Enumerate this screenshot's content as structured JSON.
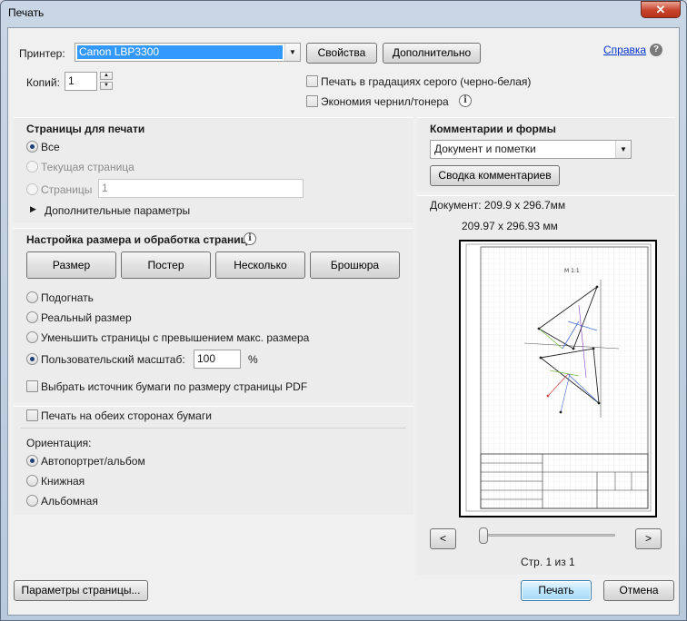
{
  "window": {
    "title": "Печать",
    "close_icon": "close-icon ✕"
  },
  "printer": {
    "label": "Принтер:",
    "selected": "Canon LBP3300",
    "properties_btn": "Свойства",
    "advanced_btn": "Дополнительно",
    "help_link": "Справка"
  },
  "copies": {
    "label": "Копий:",
    "value": "1"
  },
  "options": {
    "grayscale": "Печать в градациях серого (черно-белая)",
    "save_ink": "Экономия чернил/тонера"
  },
  "pages": {
    "heading": "Страницы для печати",
    "all": "Все",
    "current": "Текущая страница",
    "range": "Страницы",
    "range_value": "1",
    "more": "Дополнительные параметры"
  },
  "sizing": {
    "heading": "Настройка размера и обработка страниц",
    "tabs": [
      "Размер",
      "Постер",
      "Несколько",
      "Брошюра"
    ],
    "fit": "Подогнать",
    "actual": "Реальный размер",
    "shrink": "Уменьшить страницы с превышением макс. размера",
    "custom": "Пользовательский масштаб:",
    "custom_value": "100",
    "percent": "%",
    "source": "Выбрать источник бумаги по размеру страницы PDF"
  },
  "duplex": {
    "label": "Печать на обеих сторонах бумаги"
  },
  "orientation": {
    "heading": "Ориентация:",
    "auto": "Автопортрет/альбом",
    "portrait": "Книжная",
    "landscape": "Альбомная"
  },
  "comments": {
    "heading": "Комментарии и формы",
    "selected": "Документ и пометки",
    "summary_btn": "Сводка комментариев"
  },
  "preview": {
    "doc_size": "Документ: 209.9 x 296.7мм",
    "page_size": "209.97 x 296.93 мм",
    "drawing_title": "М 1:1",
    "prev": "<",
    "next": ">",
    "page_status": "Стр. 1 из 1"
  },
  "footer": {
    "page_setup_btn": "Параметры страницы...",
    "print_btn": "Печать",
    "cancel_btn": "Отмена"
  }
}
